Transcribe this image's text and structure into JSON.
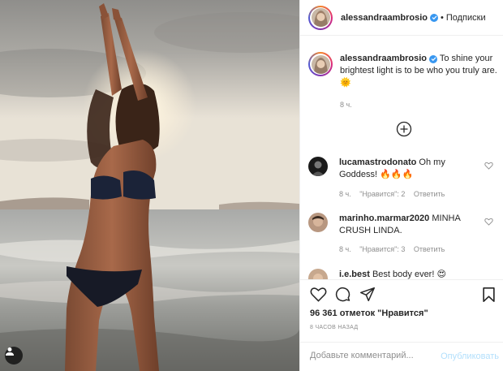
{
  "post": {
    "username": "alessandraambrosio",
    "follow_label": "Подписки",
    "dot": "•",
    "caption": "To shine your brightest light is to be who you truly are. 🌞",
    "caption_time": "8 ч.",
    "likes": "96 361 отметок \"Нравится\"",
    "posted_ago": "8 ЧАСОВ НАЗАД",
    "comment_placeholder": "Добавьте комментарий...",
    "publish_label": "Опубликовать"
  },
  "comments": [
    {
      "username": "lucamastrodonato",
      "text": "Oh my Goddess! 🔥🔥🔥",
      "time": "8 ч.",
      "likes": "\"Нравится\": 2",
      "reply": "Ответить"
    },
    {
      "username": "marinho.marmar2020",
      "text": "MINHA CRUSH LINDA.",
      "time": "8 ч.",
      "likes": "\"Нравится\": 3",
      "reply": "Ответить"
    },
    {
      "username": "i.e.best",
      "text": "Best body ever! 😍",
      "time": "",
      "likes": "",
      "reply": ""
    }
  ],
  "icons": {
    "like": "heart-icon",
    "comment": "comment-icon",
    "share": "share-icon",
    "save": "bookmark-icon",
    "load_more": "plus-circle-icon",
    "user_tag": "user-icon",
    "verified": "verified-badge-icon"
  },
  "colors": {
    "link_blue_disabled": "#b2dffc",
    "verified_blue": "#3897f0",
    "muted_text": "#8e8e8e",
    "primary_text": "#262626"
  }
}
